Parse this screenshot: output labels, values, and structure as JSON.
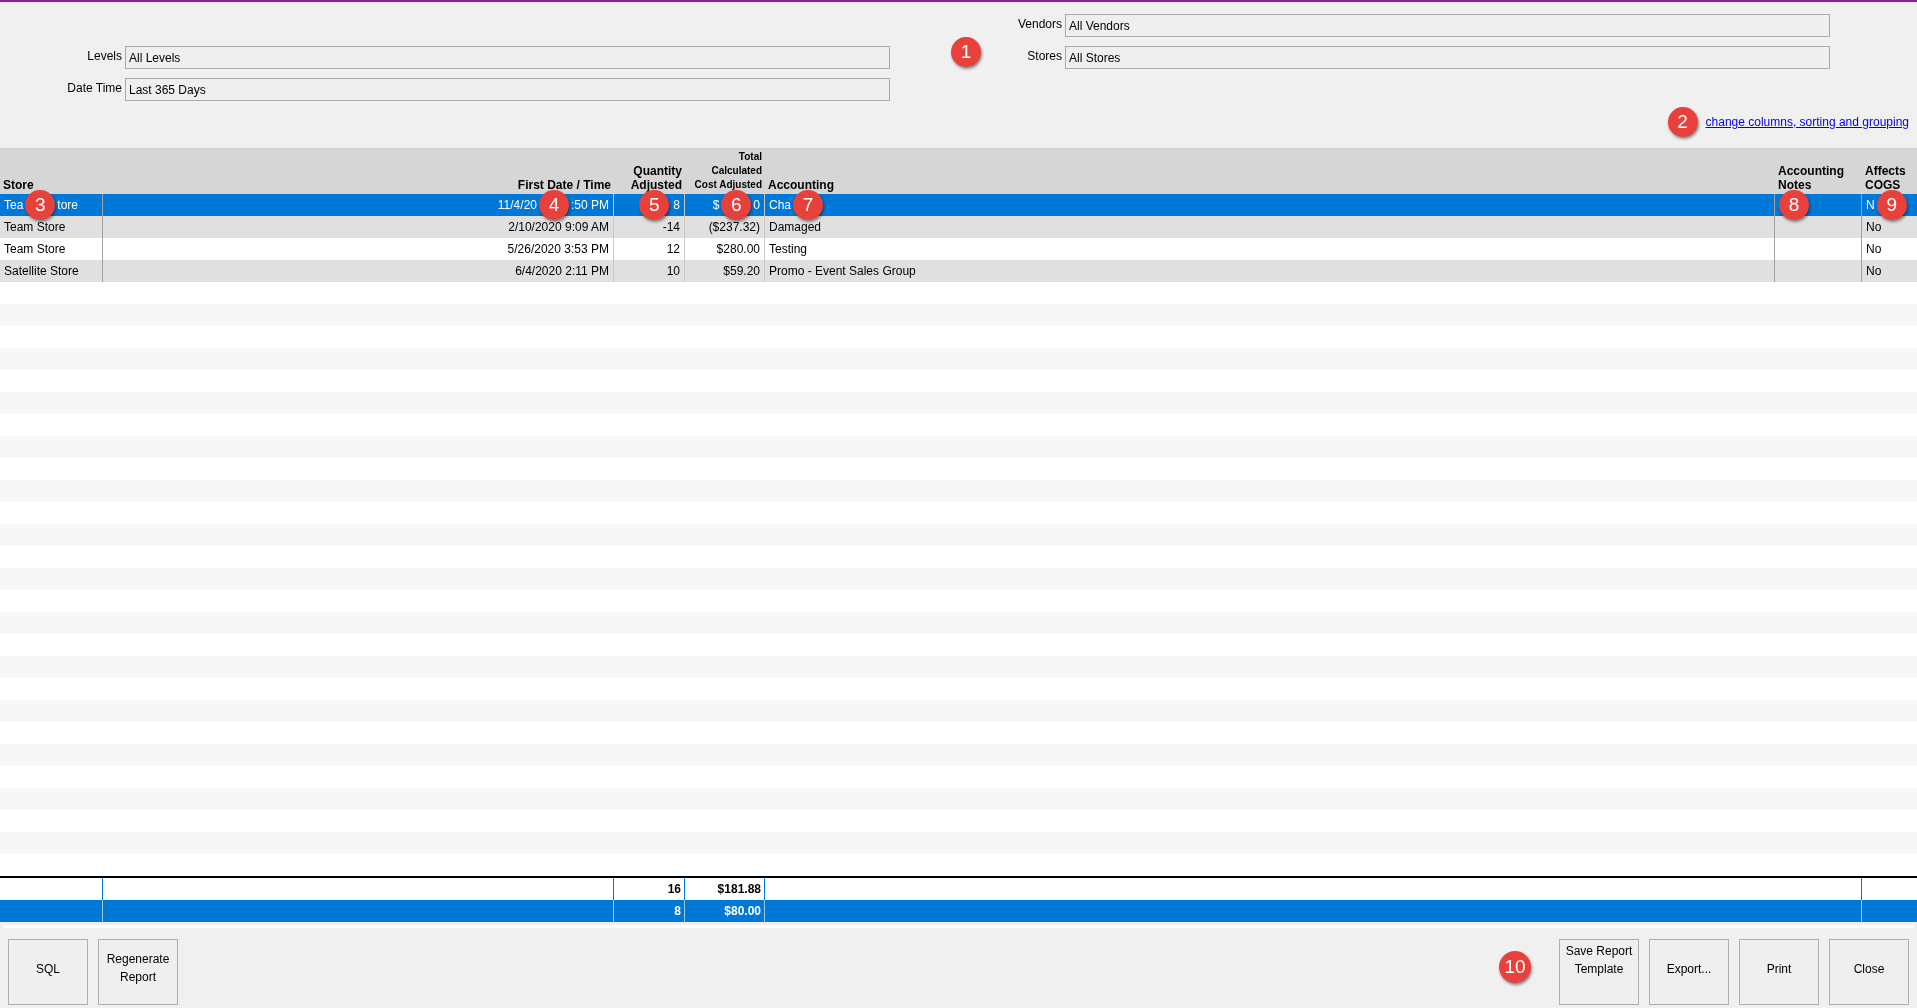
{
  "filters_left": [
    {
      "label": "Levels",
      "value": "All Levels"
    },
    {
      "label": "Date Time",
      "value": "Last 365 Days"
    }
  ],
  "filters_right": [
    {
      "label": "Vendors",
      "value": "All Vendors"
    },
    {
      "label": "Stores",
      "value": "All Stores"
    }
  ],
  "filters_badge": "1",
  "columns_link": {
    "text": "change columns, sorting and grouping",
    "badge": "2"
  },
  "table": {
    "columns": [
      {
        "label": "Store"
      },
      {
        "label": "First Date / Time"
      },
      {
        "label": "Quantity Adjusted"
      },
      {
        "label": "Total Calculated Cost Adjusted"
      },
      {
        "label": "Accounting"
      },
      {
        "label": "Accounting Notes"
      },
      {
        "label": "Affects COGS"
      }
    ],
    "rows": [
      {
        "selected": true,
        "cells": [
          {
            "parts": [
              "Tea",
              "tore"
            ],
            "badge": "3"
          },
          {
            "parts": [
              "11/4/20",
              ":50 PM"
            ],
            "badge": "4"
          },
          {
            "parts": [
              "8"
            ],
            "badge": "5"
          },
          {
            "parts": [
              "$",
              "0"
            ],
            "badge": "6"
          },
          {
            "parts": [
              "Cha"
            ],
            "badge": "7"
          },
          {
            "badge": "8"
          },
          {
            "parts": [
              "N"
            ],
            "badge": "9"
          }
        ]
      },
      {
        "selected": false,
        "cells": [
          {
            "parts": [
              "Team Store"
            ]
          },
          {
            "parts": [
              "2/10/2020 9:09 AM"
            ]
          },
          {
            "parts": [
              "-14"
            ]
          },
          {
            "parts": [
              "($237.32)"
            ]
          },
          {
            "parts": [
              "Damaged"
            ]
          },
          {},
          {
            "parts": [
              "No"
            ]
          }
        ]
      },
      {
        "selected": false,
        "cells": [
          {
            "parts": [
              "Team Store"
            ]
          },
          {
            "parts": [
              "5/26/2020 3:53 PM"
            ]
          },
          {
            "parts": [
              "12"
            ]
          },
          {
            "parts": [
              "$280.00"
            ]
          },
          {
            "parts": [
              "Testing"
            ]
          },
          {},
          {
            "parts": [
              "No"
            ]
          }
        ]
      },
      {
        "selected": false,
        "cells": [
          {
            "parts": [
              "Satellite Store"
            ]
          },
          {
            "parts": [
              "6/4/2020 2:11 PM"
            ]
          },
          {
            "parts": [
              "10"
            ]
          },
          {
            "parts": [
              "$59.20"
            ]
          },
          {
            "parts": [
              "Promo - Event Sales Group"
            ]
          },
          {},
          {
            "parts": [
              "No"
            ]
          }
        ]
      }
    ],
    "totals": [
      {
        "selected": false,
        "quantity": "16",
        "cost": "$181.88"
      },
      {
        "selected": true,
        "quantity": "8",
        "cost": "$80.00"
      }
    ]
  },
  "buttons_left": [
    "SQL",
    "Regenerate Report"
  ],
  "buttons_right": [
    "Save Report Template",
    "Export...",
    "Print",
    "Close"
  ],
  "buttons_badge": "10"
}
